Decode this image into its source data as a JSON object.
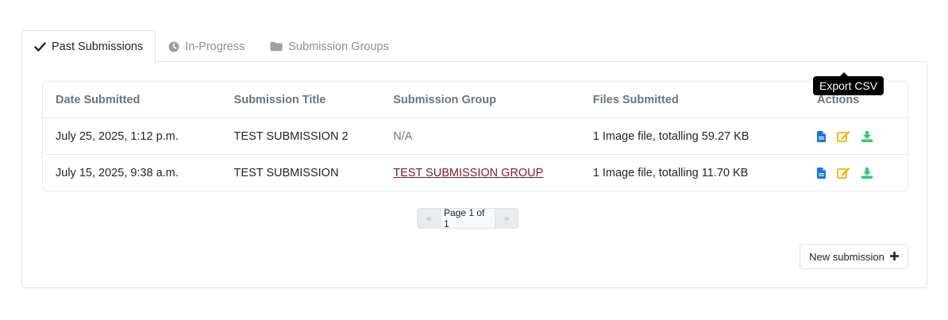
{
  "tabs": [
    {
      "label": "Past Submissions",
      "icon": "check-icon",
      "active": true
    },
    {
      "label": "In-Progress",
      "icon": "clock-icon",
      "active": false
    },
    {
      "label": "Submission Groups",
      "icon": "folder-icon",
      "active": false
    }
  ],
  "table": {
    "headers": [
      "Date Submitted",
      "Submission Title",
      "Submission Group",
      "Files Submitted",
      "Actions"
    ],
    "rows": [
      {
        "date": "July 25, 2025, 1:12 p.m.",
        "title": "TEST SUBMISSION 2",
        "group": "N/A",
        "group_is_link": false,
        "files": "1 Image file, totalling 59.27 KB"
      },
      {
        "date": "July 15, 2025, 9:38 a.m.",
        "title": "TEST SUBMISSION",
        "group": "TEST SUBMISSION GROUP",
        "group_is_link": true,
        "files": "1 Image file, totalling 11.70 KB"
      }
    ],
    "action_icons": [
      "document-icon",
      "edit-icon",
      "download-icon"
    ]
  },
  "tooltip": {
    "text": "Export CSV"
  },
  "pagination": {
    "prev": "«",
    "current": "Page 1 of 1",
    "next": "»"
  },
  "new_button": {
    "label": "New submission",
    "icon": "plus-icon"
  },
  "colors": {
    "doc_icon": "#1a73e8",
    "edit_icon": "#f0b400",
    "download_icon": "#2ecc71",
    "link": "#7a1f1f"
  }
}
